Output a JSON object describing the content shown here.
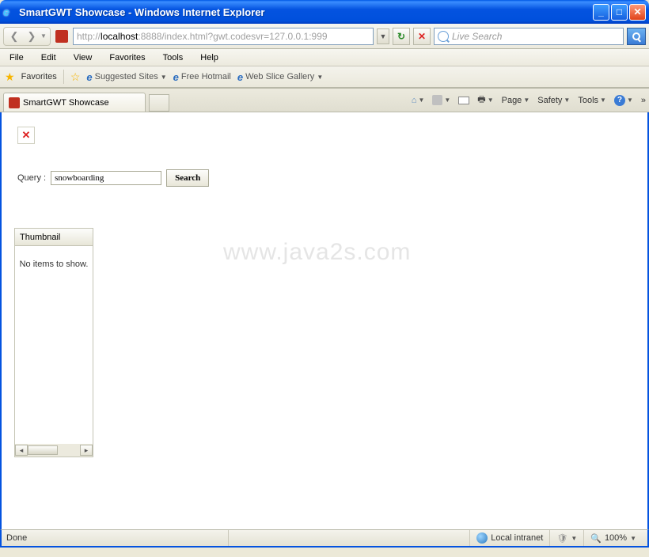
{
  "window": {
    "title": "SmartGWT Showcase - Windows Internet Explorer"
  },
  "nav": {
    "url_grey_pre": "http://",
    "url_host": "localhost",
    "url_grey_post": ":8888/index.html?gwt.codesvr=127.0.0.1:999",
    "search_placeholder": "Live Search"
  },
  "menu": {
    "file": "File",
    "edit": "Edit",
    "view": "View",
    "favorites": "Favorites",
    "tools": "Tools",
    "help": "Help"
  },
  "favbar": {
    "favorites": "Favorites",
    "suggested": "Suggested Sites",
    "hotmail": "Free Hotmail",
    "webslice": "Web Slice Gallery"
  },
  "tabs": {
    "active": "SmartGWT Showcase"
  },
  "tabtools": {
    "page": "Page",
    "safety": "Safety",
    "tools": "Tools"
  },
  "page": {
    "query_label": "Query :",
    "query_value": "snowboarding",
    "search_btn": "Search",
    "grid_header": "Thumbnail",
    "empty_msg": "No items to show."
  },
  "watermark": "www.java2s.com",
  "status": {
    "done": "Done",
    "zone": "Local intranet",
    "zoom": "100%"
  }
}
